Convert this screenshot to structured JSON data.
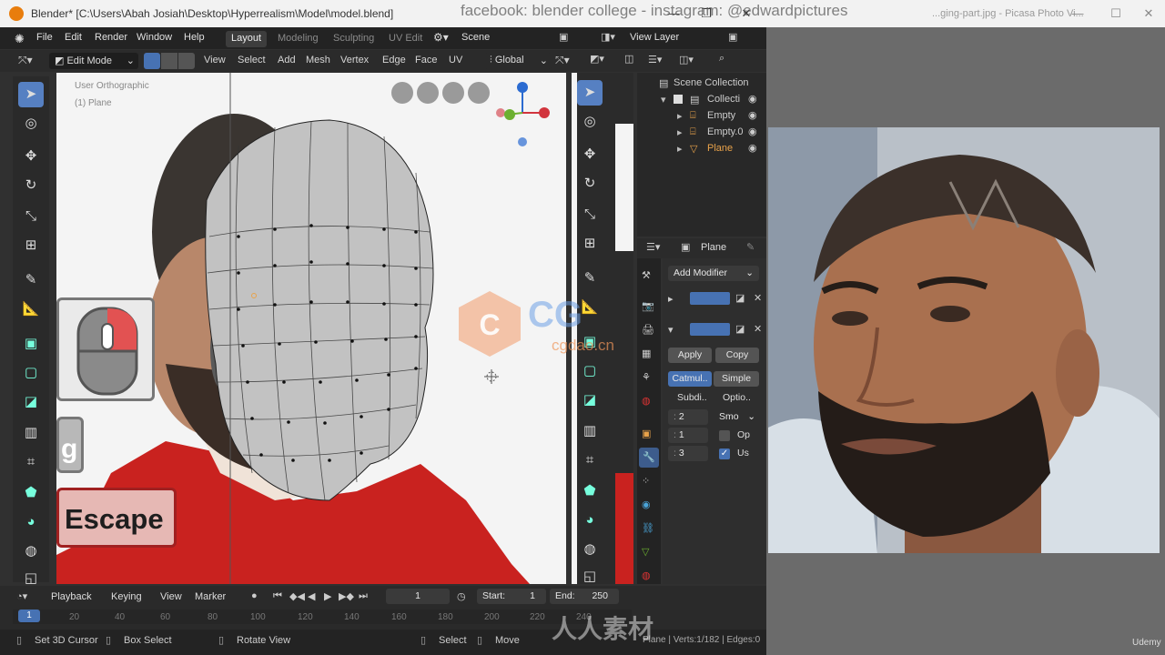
{
  "blender": {
    "title": "Blender* [C:\\Users\\Abah Josiah\\Desktop\\Hyperrealism\\Model\\model.blend]",
    "menus": [
      "File",
      "Edit",
      "Render",
      "Window",
      "Help"
    ],
    "workspaces": [
      "Layout",
      "Modeling",
      "Sculpting",
      "UV Edit"
    ],
    "scene": "Scene",
    "view_layer": "View Layer",
    "header": {
      "mode": "Edit Mode",
      "items": [
        "View",
        "Select",
        "Add",
        "Mesh",
        "Vertex",
        "Edge",
        "Face",
        "UV"
      ],
      "transform": "Global"
    },
    "viewport": {
      "label1": "User Orthographic",
      "label2": "(1) Plane",
      "key_g": "g",
      "key_escape": "Escape"
    },
    "outliner": {
      "rows": [
        {
          "name": "Scene Collection"
        },
        {
          "name": "Collecti"
        },
        {
          "name": "Empty"
        },
        {
          "name": "Empty.0"
        },
        {
          "name": "Plane"
        }
      ]
    },
    "properties": {
      "object_name": "Plane",
      "add_modifier": "Add Modifier",
      "apply": "Apply",
      "copy": "Copy",
      "catmull": "Catmul..",
      "simple": "Simple",
      "subdiv": "Subdi..",
      "options": "Optio..",
      "level1": "2",
      "level2": "1",
      "level3": "3",
      "smooth": "Smo",
      "op": "Op",
      "us": "Us"
    },
    "timeline": {
      "menus": [
        "Playback",
        "Keying",
        "View",
        "Marker"
      ],
      "current_frame": "1",
      "start_label": "Start:",
      "start": "1",
      "end_label": "End:",
      "end": "250",
      "ruler": [
        "1",
        "20",
        "40",
        "60",
        "80",
        "100",
        "120",
        "140",
        "160",
        "180",
        "200",
        "220",
        "240"
      ]
    },
    "statusbar": {
      "set_cursor": "Set 3D Cursor",
      "box_select": "Box Select",
      "rotate_view": "Rotate View",
      "select": "Select",
      "move": "Move",
      "stats": "Plane | Verts:1/182 | Edges:0"
    }
  },
  "photo_viewer": {
    "title": "...ging-part.jpg - Picasa Photo Vi..."
  },
  "overlay": {
    "watermark_top": "facebook: blender college - instagram: @edwardpictures",
    "cg_logo": "CG",
    "cg_url": "cgdao.cn",
    "bottom_logo": "人人素材",
    "udemy": "Udemy"
  },
  "colors": {
    "accent": "#4772b3",
    "active_tool": "#5680c2",
    "plane_orange": "#e8a24a"
  }
}
